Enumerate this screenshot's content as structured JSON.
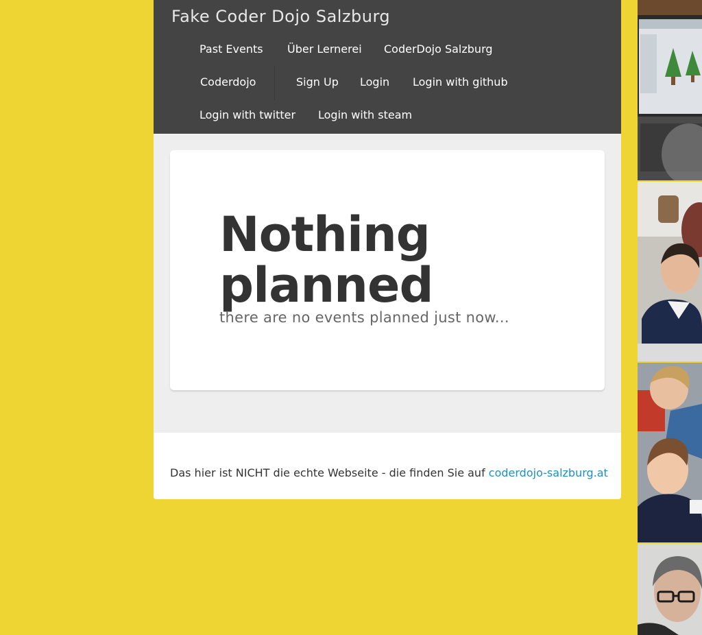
{
  "site": {
    "title": "Fake Coder Dojo Salzburg"
  },
  "nav": {
    "items": [
      {
        "label": "Past Events"
      },
      {
        "label": "Über Lernerei"
      },
      {
        "label": "CoderDojo Salzburg"
      },
      {
        "label": "Coderdojo"
      },
      {
        "label": "Sign Up"
      },
      {
        "label": "Login"
      },
      {
        "label": "Login with github"
      },
      {
        "label": "Login with twitter"
      },
      {
        "label": "Login with steam"
      }
    ]
  },
  "main": {
    "heading": "Nothing planned",
    "subheading": "there are no events planned just now..."
  },
  "footer": {
    "text": "Das hier ist NICHT die echte Webseite - die finden Sie auf",
    "link_label": "coderdojo-salzburg.at"
  },
  "colors": {
    "page_background": "#efd533",
    "header_background": "#444444",
    "link": "#1b8fc9"
  }
}
